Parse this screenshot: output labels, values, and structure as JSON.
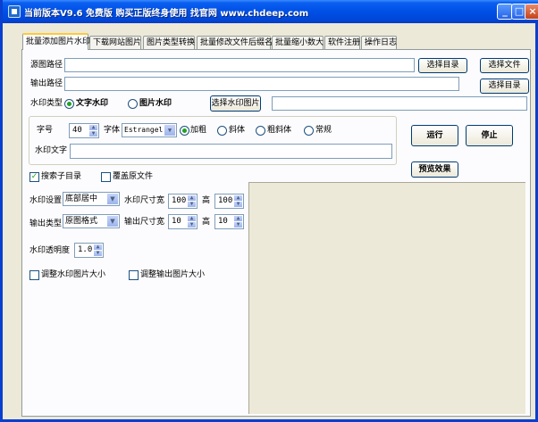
{
  "window": {
    "title": "当前版本V9.6 免费版 购买正版终身使用 找官网 www.chdeep.com",
    "minimize": "_",
    "maximize": "□",
    "close": "×"
  },
  "tabs": [
    {
      "label": "批量添加图片水印"
    },
    {
      "label": "下载网站图片"
    },
    {
      "label": "图片类型转换"
    },
    {
      "label": "批量修改文件后缀名"
    },
    {
      "label": "批量缩小数大"
    },
    {
      "label": "软件注册"
    },
    {
      "label": "操作日志"
    }
  ],
  "paths": {
    "source_label": "源图路径",
    "source_value": "",
    "output_label": "输出路径",
    "output_value": "",
    "select_dir_label": "选择目录",
    "select_file_label": "选择文件",
    "select_output_dir_label": "选择目录"
  },
  "watermark_type": {
    "label": "水印类型",
    "text_option": "文字水印",
    "image_option": "图片水印",
    "select_image_label": "选择水印图片",
    "image_path": ""
  },
  "font": {
    "size_label": "字号",
    "size_value": "40",
    "family_label": "字体",
    "family_value": "Estrangelo",
    "bold": "加粗",
    "italic": "斜体",
    "bold_italic": "粗斜体",
    "regular": "常规",
    "text_label": "水印文字",
    "text_value": ""
  },
  "actions": {
    "run": "运行",
    "stop": "停止",
    "preview": "预览效果"
  },
  "options": {
    "search_subdirs": "搜索子目录",
    "overwrite": "覆盖原文件"
  },
  "settings": {
    "position_label": "水印设置",
    "position_value": "底部居中",
    "wm_size_label": "水印尺寸",
    "width_label": "宽",
    "wm_width": "100",
    "height_label": "高",
    "wm_height": "100",
    "output_type_label": "输出类型",
    "output_type_value": "原图格式",
    "out_size_label": "输出尺寸",
    "out_width_label": "宽",
    "out_width": "10",
    "out_height_label": "高",
    "out_height": "10",
    "opacity_label": "水印透明度",
    "opacity_value": "1.0",
    "resize_wm": "调整水印图片大小",
    "resize_out": "调整输出图片大小"
  }
}
